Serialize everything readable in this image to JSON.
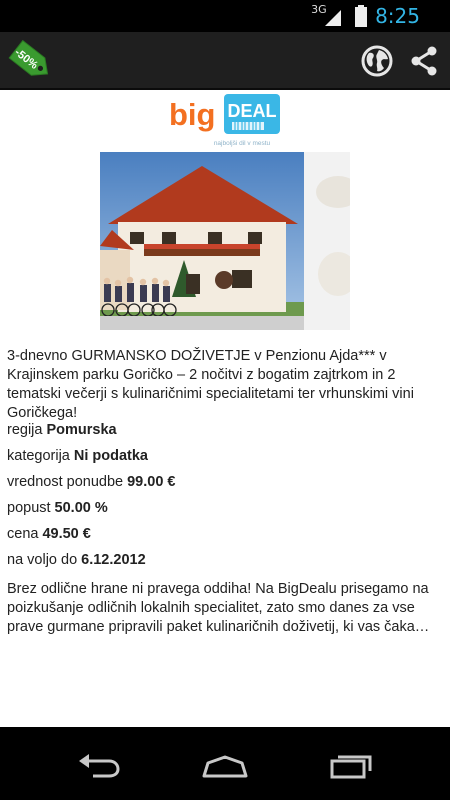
{
  "status_bar": {
    "network": "3G",
    "time": "8:25"
  },
  "action_bar": {
    "badge": "-50%",
    "globe_icon": "globe-icon",
    "share_icon": "share-icon"
  },
  "logo": {
    "big": "big",
    "deal": "DEAL",
    "tagline": "najboljši dil v mestu"
  },
  "deal": {
    "title": "3-dnevno GURMANSKO DOŽIVETJE v Penzionu Ajda*** v Krajinskem parku Goričko – 2 nočitvi z bogatim zajtrkom in 2 tematski večerji s kulinaričnimi specialitetami ter vrhunskimi vini Goričkega!",
    "region_label": "regija",
    "region_value": "Pomurska",
    "category_label": "kategorija",
    "category_value": "Ni podatka",
    "value_label": "vrednost ponudbe",
    "value_value": "99.00 €",
    "discount_label": "popust",
    "discount_value": "50.00 %",
    "price_label": "cena",
    "price_value": "49.50 €",
    "until_label": "na voljo do",
    "until_value": "6.12.2012",
    "description": "Brez odlične hrane ni pravega oddiha! Na BigDealu prisegamo na poizkušanje odličnih lokalnih specialitet, zato smo danes za vse prave gurmane pripravili paket kulinaričnih doživetij, ki vas čaka…"
  },
  "colors": {
    "accent": "#33b5e5",
    "logo_orange": "#f37021",
    "logo_blue": "#3ab7e6",
    "tag_green": "#3a9a2f"
  }
}
